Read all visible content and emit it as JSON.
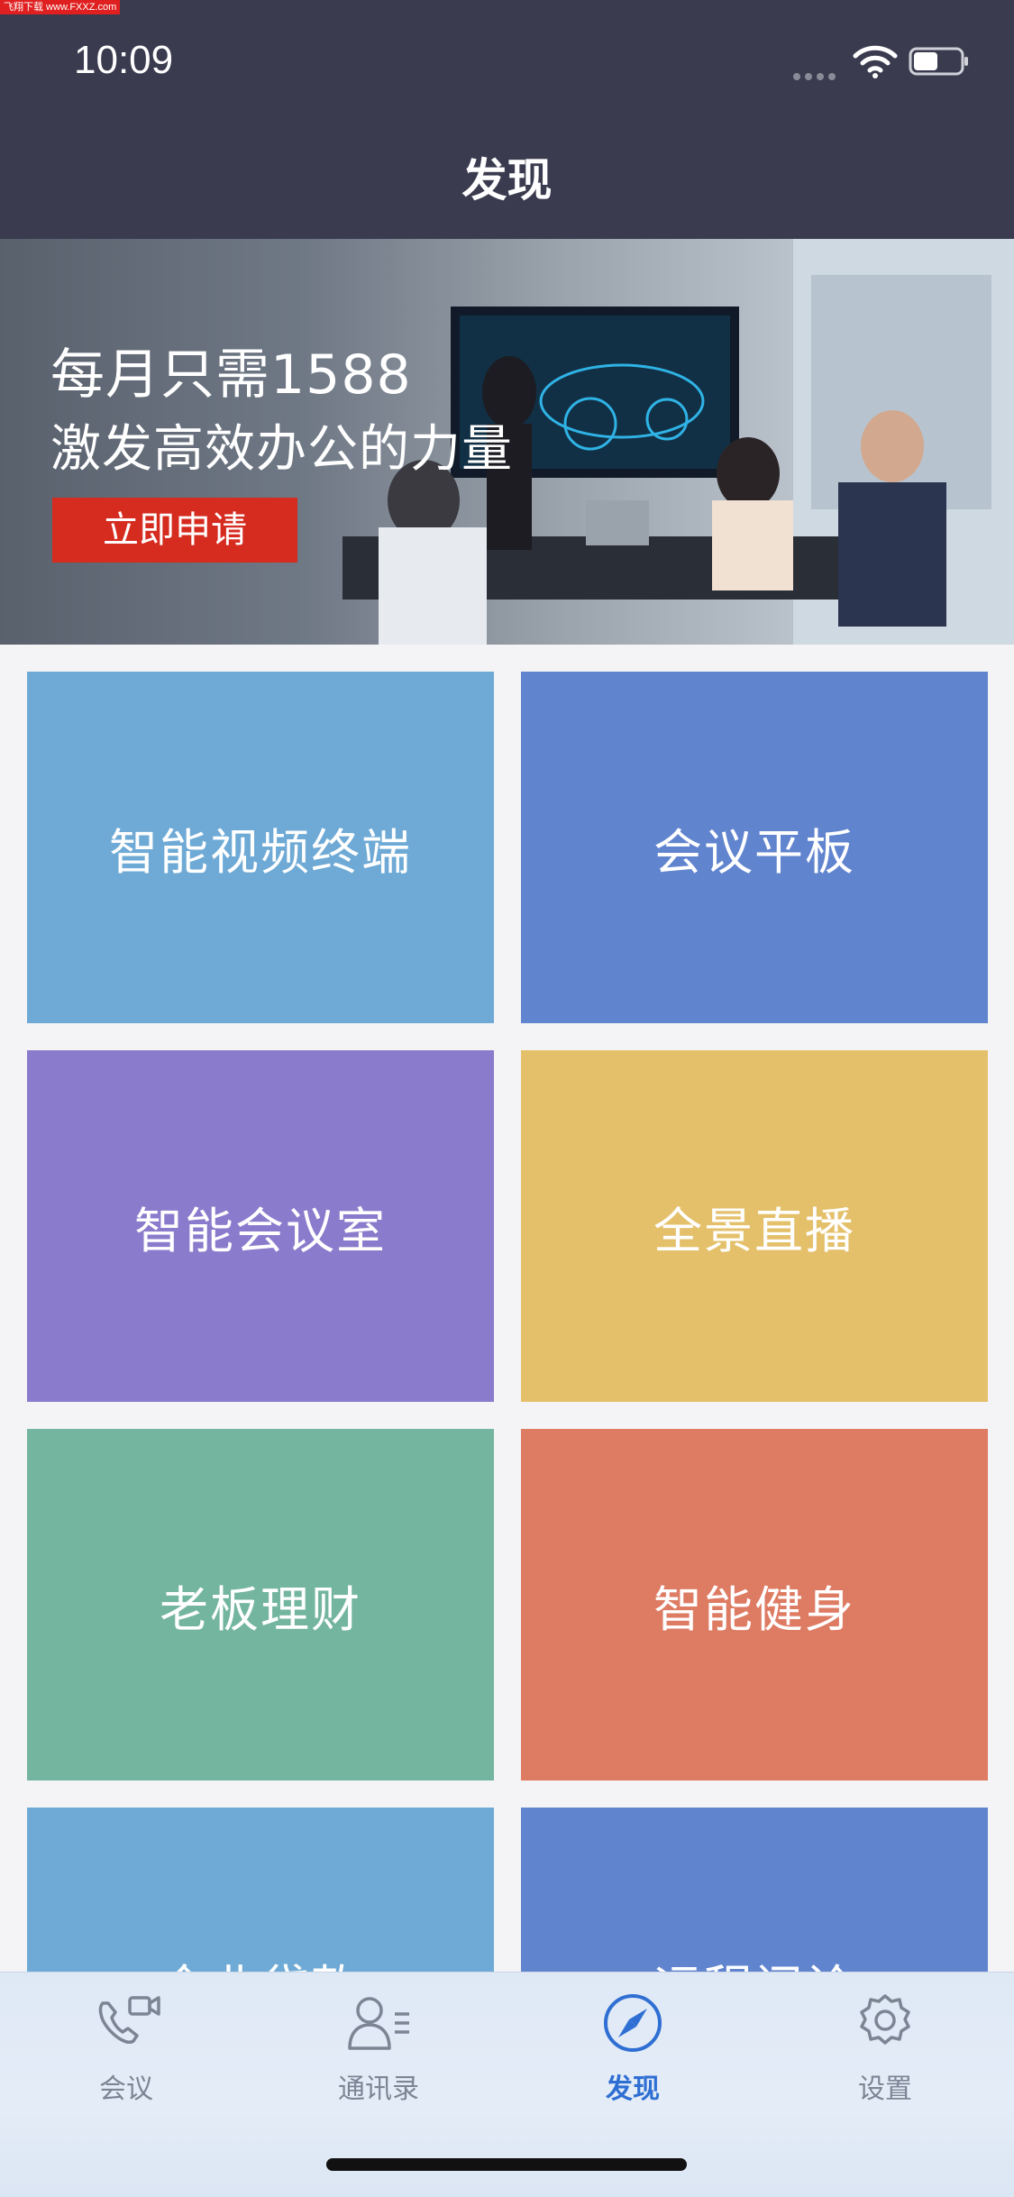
{
  "watermark": "飞翔下载 www.FXXZ.com",
  "status_bar": {
    "time": "10:09",
    "icons": [
      "signal-dots-icon",
      "wifi-icon",
      "battery-icon"
    ]
  },
  "nav": {
    "title": "发现"
  },
  "banner": {
    "line1": "每月只需1588",
    "line2": "激发高效办公的力量",
    "button_label": "立即申请",
    "button_color": "#d62b1f"
  },
  "tiles": [
    {
      "label": "智能视频终端",
      "color": "#6eaad5"
    },
    {
      "label": "会议平板",
      "color": "#6184cf"
    },
    {
      "label": "智能会议室",
      "color": "#8a7bcc"
    },
    {
      "label": "全景直播",
      "color": "#e4c06b"
    },
    {
      "label": "老板理财",
      "color": "#74b59f"
    },
    {
      "label": "智能健身",
      "color": "#de7b63"
    },
    {
      "label": "企业贷款",
      "color": "#6eaad5"
    },
    {
      "label": "远程问诊",
      "color": "#6184cf"
    }
  ],
  "tabbar": {
    "items": [
      {
        "label": "会议",
        "icon": "video-call-icon",
        "active": false
      },
      {
        "label": "通讯录",
        "icon": "contacts-icon",
        "active": false
      },
      {
        "label": "发现",
        "icon": "compass-icon",
        "active": true
      },
      {
        "label": "设置",
        "icon": "gear-icon",
        "active": false
      }
    ],
    "active_color": "#2f6fd3",
    "inactive_color": "#7c8594"
  },
  "corner_logo": "飞翔下载 www.fxxz.com"
}
